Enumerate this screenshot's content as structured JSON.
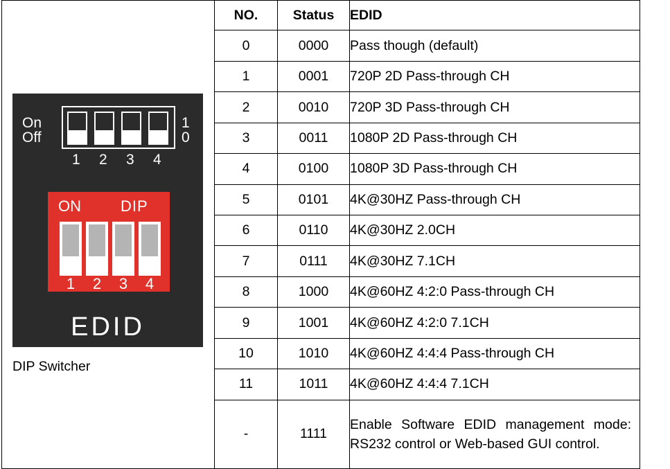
{
  "dip_panel": {
    "top_switch": {
      "on_label": "On",
      "off_label": "Off",
      "one_label": "1",
      "zero_label": "0",
      "numbers": [
        "1",
        "2",
        "3",
        "4"
      ]
    },
    "red_switch": {
      "on_label": "ON",
      "dip_label": "DIP",
      "numbers": [
        "1",
        "2",
        "3",
        "4"
      ]
    },
    "edid_label": "EDID",
    "colors": {
      "panel": "#2b2b2b",
      "red": "#e0312a",
      "knob": "#b4b4b4"
    }
  },
  "caption": "DIP Switcher",
  "table": {
    "headers": {
      "no": "NO.",
      "status": "Status",
      "edid": "EDID"
    },
    "rows": [
      {
        "no": "0",
        "status": "0000",
        "edid": "Pass though (default)"
      },
      {
        "no": "1",
        "status": "0001",
        "edid": "720P 2D Pass-through CH"
      },
      {
        "no": "2",
        "status": "0010",
        "edid": "720P 3D Pass-through CH"
      },
      {
        "no": "3",
        "status": "0011",
        "edid": "1080P 2D Pass-through CH"
      },
      {
        "no": "4",
        "status": "0100",
        "edid": "1080P 3D Pass-through CH"
      },
      {
        "no": "5",
        "status": "0101",
        "edid": "4K@30HZ Pass-through CH"
      },
      {
        "no": "6",
        "status": "0110",
        "edid": "4K@30HZ 2.0CH"
      },
      {
        "no": "7",
        "status": "0111",
        "edid": "4K@30HZ 7.1CH"
      },
      {
        "no": "8",
        "status": "1000",
        "edid": "4K@60HZ 4:2:0 Pass-through CH"
      },
      {
        "no": "9",
        "status": "1001",
        "edid": "4K@60HZ 4:2:0 7.1CH"
      },
      {
        "no": "10",
        "status": "1010",
        "edid": "4K@60HZ 4:4:4 Pass-through CH"
      },
      {
        "no": "11",
        "status": "1011",
        "edid": "4K@60HZ 4:4:4 7.1CH"
      },
      {
        "no": "-",
        "status": "1111",
        "edid": "Enable Software EDID management mode: RS232 control or Web-based GUI control."
      }
    ]
  }
}
